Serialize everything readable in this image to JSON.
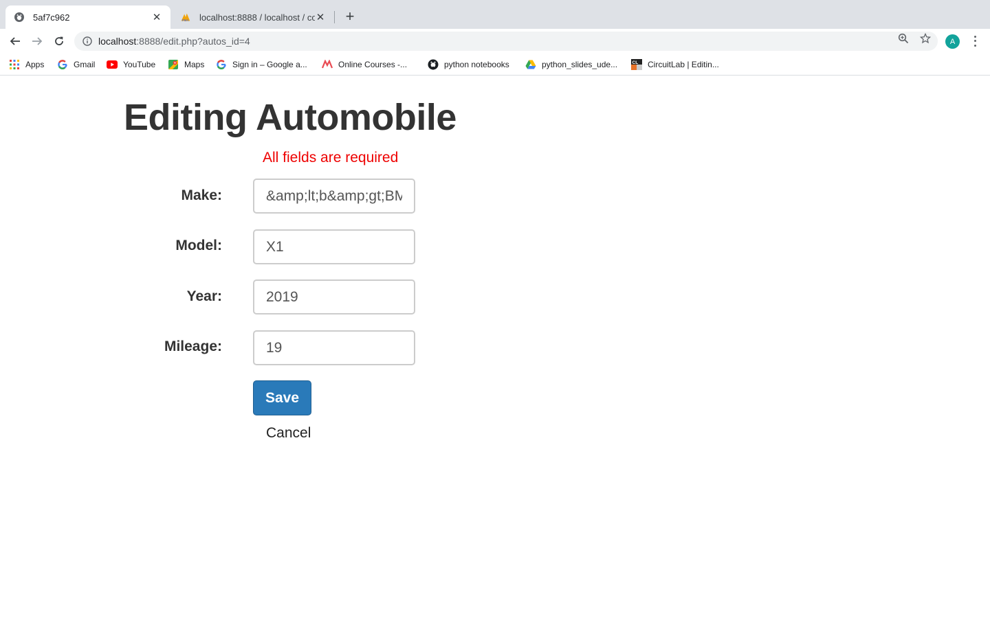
{
  "browser": {
    "tabs": [
      {
        "title": "5af7c962",
        "active": true,
        "icon": "github-icon"
      },
      {
        "title": "localhost:8888 / localhost / co",
        "active": false,
        "icon": "phpmyadmin-icon"
      }
    ],
    "url": {
      "host": "localhost",
      "path": ":8888/edit.php?autos_id=4"
    },
    "avatar_letter": "A",
    "avatar_color": "#12a39b",
    "bookmarks": [
      {
        "label": "Apps",
        "icon": "apps-grid-icon"
      },
      {
        "label": "Gmail",
        "icon": "google-icon"
      },
      {
        "label": "YouTube",
        "icon": "youtube-icon"
      },
      {
        "label": "Maps",
        "icon": "maps-icon"
      },
      {
        "label": "Sign in – Google a...",
        "icon": "google-icon"
      },
      {
        "label": "Online Courses -...",
        "icon": "udemy-icon"
      },
      {
        "label": "python notebooks",
        "icon": "github-icon"
      },
      {
        "label": "python_slides_ude...",
        "icon": "google-drive-icon"
      },
      {
        "label": "CircuitLab | Editin...",
        "icon": "circuitlab-icon"
      }
    ]
  },
  "page": {
    "title": "Editing Automobile",
    "error": "All fields are required",
    "error_color": "#ee0000",
    "fields": {
      "make": {
        "label": "Make:",
        "value": "&amp;lt;b&amp;gt;BMW"
      },
      "model": {
        "label": "Model:",
        "value": "X1"
      },
      "year": {
        "label": "Year:",
        "value": "2019"
      },
      "mileage": {
        "label": "Mileage:",
        "value": "19"
      }
    },
    "save_label": "Save",
    "save_color": "#2a7ab9",
    "cancel_label": "Cancel"
  }
}
